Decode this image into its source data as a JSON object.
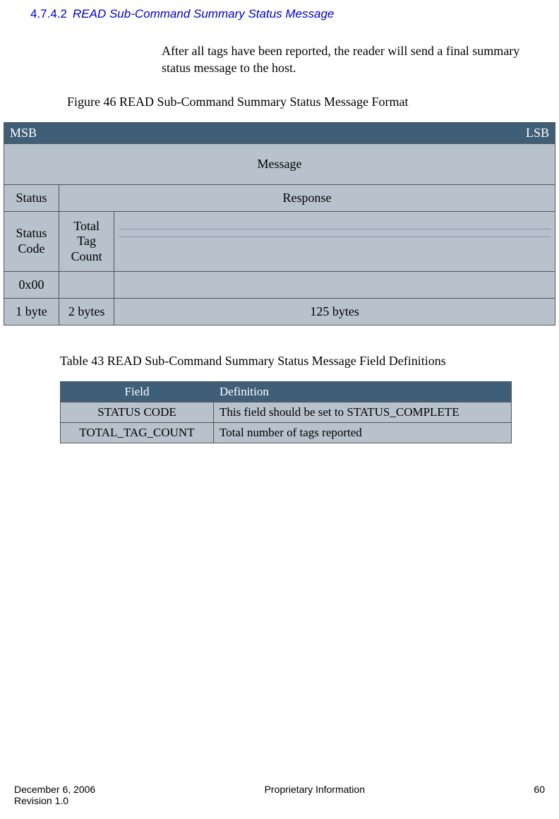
{
  "heading": {
    "number": "4.7.4.2",
    "title": "READ Sub-Command Summary Status Message"
  },
  "paragraph": "After all tags have been reported, the reader will send a final summary status message to the host.",
  "figure": {
    "caption": "Figure 46 READ Sub-Command Summary Status Message Format",
    "header_left": "MSB",
    "header_right": "LSB",
    "row_message": "Message",
    "row_status": "Status",
    "row_response": "Response",
    "row_status_code": "Status Code",
    "row_total_tag_count": "Total Tag Count",
    "row_0x00": "0x00",
    "row_1byte": "1 byte",
    "row_2bytes": "2 bytes",
    "row_125bytes": "125 bytes"
  },
  "table": {
    "caption": "Table 43 READ Sub-Command Summary Status Message Field Definitions",
    "header_field": "Field",
    "header_definition": "Definition",
    "rows": [
      {
        "field": "STATUS CODE",
        "definition": "This field should be set to STATUS_COMPLETE"
      },
      {
        "field": "TOTAL_TAG_COUNT",
        "definition": "Total number of tags reported"
      }
    ]
  },
  "footer": {
    "date": "December 6, 2006",
    "revision": "Revision 1.0",
    "center": "Proprietary Information",
    "page": "60"
  }
}
